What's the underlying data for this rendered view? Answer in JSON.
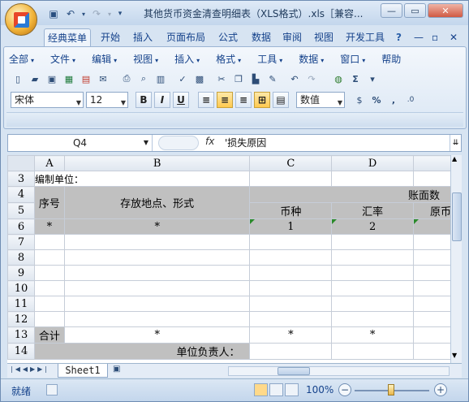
{
  "window": {
    "title": "其他货币资金清查明细表（XLS格式）.xls［兼容...",
    "controls": [
      "—",
      "▭",
      "✕"
    ]
  },
  "tabs": [
    "经典菜单",
    "开始",
    "插入",
    "页面布局",
    "公式",
    "数据",
    "审阅",
    "视图",
    "开发工具"
  ],
  "ribbon": {
    "menu": [
      "全部",
      "文件",
      "编辑",
      "视图",
      "插入",
      "格式",
      "工具",
      "数据",
      "窗口",
      "帮助"
    ],
    "font_name": "宋体",
    "font_size": "12",
    "bold": "B",
    "italic": "I",
    "underline": "U",
    "number_format": "数值",
    "percent": "%",
    "comma": ",",
    "sigma": "Σ"
  },
  "formula_bar": {
    "name_box": "Q4",
    "fx": "fx",
    "content": "'损失原因"
  },
  "grid": {
    "columns": [
      "A",
      "B",
      "C",
      "D"
    ],
    "rows": [
      "3",
      "4",
      "5",
      "6",
      "7",
      "8",
      "9",
      "10",
      "11",
      "12",
      "13",
      "14"
    ],
    "r3_label": "编制单位：",
    "seq_header": "序号",
    "location_header": "存放地点、形式",
    "book_header": "账面数",
    "currency_header": "币种",
    "rate_header": "汇率",
    "orig_header": "原币",
    "r6_a": "*",
    "r6_b": "*",
    "r6_c": "1",
    "r6_d": "2",
    "total_label": "合计",
    "r13_b": "*",
    "r13_c": "*",
    "r13_d": "*",
    "owner_label": "单位负责人："
  },
  "sheets": [
    "Sheet1"
  ],
  "status": {
    "ready": "就绪",
    "zoom": "100%"
  }
}
